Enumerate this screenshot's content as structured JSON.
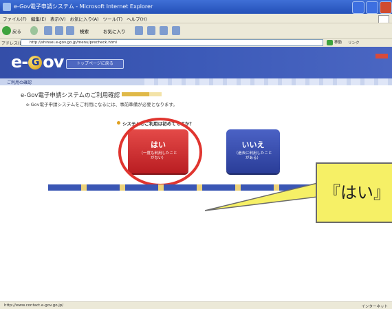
{
  "window": {
    "title": "e-Gov電子申請システム - Microsoft Internet Explorer"
  },
  "menu": [
    "ファイル(F)",
    "編集(E)",
    "表示(V)",
    "お気に入り(A)",
    "ツール(T)",
    "ヘルプ(H)"
  ],
  "toolbar": {
    "back_label": "戻る",
    "search_label": "検索",
    "favorites_label": "お気に入り"
  },
  "address": {
    "label": "アドレス(D)",
    "url": "http://shinsei.e-gov.go.jp/menu/precheck.html",
    "go_label": "移動",
    "links_label": "リンク"
  },
  "banner": {
    "logo": "e-Gov",
    "top_button": "トップページに戻る"
  },
  "breadcrumb": "ご利用の確認",
  "heading": "e-Gov電子申請システムのご利用確認",
  "subtext": "e-Gov電子申請システムをご利用になるには、事前準備が必要となります。",
  "question": "システムのご利用は初めてですか？",
  "yes": {
    "label": "はい",
    "sub1": "（一度も利用したこと",
    "sub2": "がない）"
  },
  "no": {
    "label": "いいえ",
    "sub1": "（過去に利用したこと",
    "sub2": "がある）"
  },
  "callout": {
    "text": "『はい』"
  },
  "status": {
    "url": "http://www.contact.e-gov.go.jp/",
    "zone": "インターネット"
  },
  "colors": {
    "yes": "#c8262b",
    "no": "#3a4fb0",
    "highlight": "#e0352f",
    "callout": "#f6f066"
  }
}
